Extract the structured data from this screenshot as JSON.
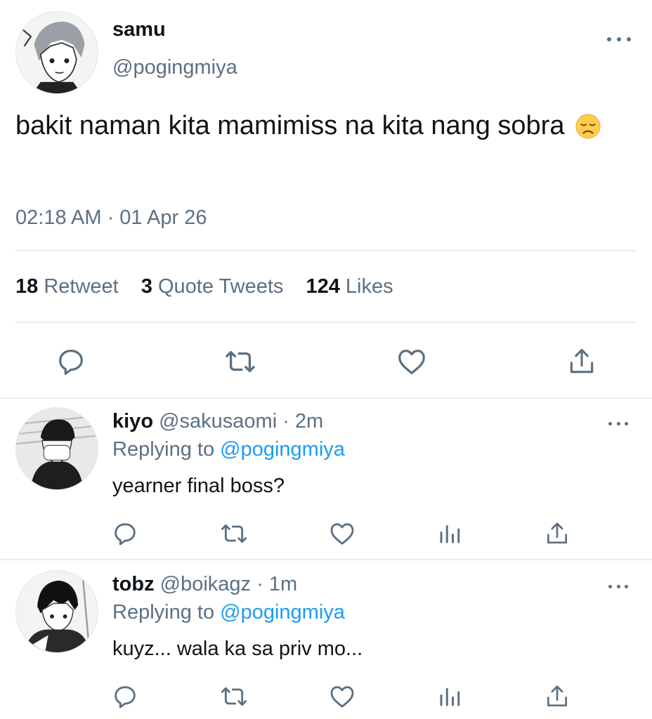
{
  "tweet": {
    "display_name": "samu",
    "handle": "@pogingmiya",
    "text": "bakit naman kita mamimiss na kita nang sobra",
    "emoji": "disappointed-face",
    "timestamp": "02:18 AM · 01 Apr 26",
    "stats": {
      "retweets_count": "18",
      "retweets_label": "Retweet",
      "quotes_count": "3",
      "quotes_label": "Quote Tweets",
      "likes_count": "124",
      "likes_label": "Likes"
    },
    "actions": [
      "reply",
      "retweet",
      "like",
      "share"
    ]
  },
  "replies": [
    {
      "display_name": "kiyo",
      "handle": "@sakusaomi",
      "time": "· 2m",
      "replying_prefix": "Replying to",
      "replying_to": "@pogingmiya",
      "text": "yearner final boss?",
      "actions": [
        "reply",
        "retweet",
        "like",
        "analytics",
        "share"
      ]
    },
    {
      "display_name": "tobz",
      "handle": "@boikagz",
      "time": "· 1m",
      "replying_prefix": "Replying to",
      "replying_to": "@pogingmiya",
      "text": "kuyz... wala ka sa priv mo...",
      "actions": [
        "reply",
        "retweet",
        "like",
        "analytics",
        "share"
      ]
    }
  ],
  "colors": {
    "text": "#0f1419",
    "muted": "#5b7083",
    "link": "#1d9bf0",
    "divider": "#e6ecf0",
    "emoji_fill": "#ffcc4d"
  }
}
